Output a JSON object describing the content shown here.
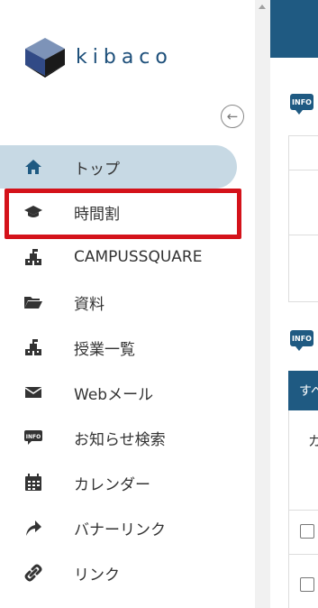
{
  "app": {
    "name": "kibaco"
  },
  "sidebar": {
    "collapse_icon": "arrow-left-circle-icon",
    "items": [
      {
        "label": "トップ",
        "icon": "home-icon",
        "active": true
      },
      {
        "label": "時間割",
        "icon": "graduation-cap-icon",
        "active": false
      },
      {
        "label": "CAMPUSSQUARE",
        "icon": "school-building-icon",
        "active": false
      },
      {
        "label": "資料",
        "icon": "folder-open-icon",
        "active": false
      },
      {
        "label": "授業一覧",
        "icon": "school-building-icon",
        "active": false
      },
      {
        "label": "Webメール",
        "icon": "envelope-icon",
        "active": false
      },
      {
        "label": "お知らせ検索",
        "icon": "info-chat-icon",
        "active": false
      },
      {
        "label": "カレンダー",
        "icon": "calendar-icon",
        "active": false
      },
      {
        "label": "バナーリンク",
        "icon": "share-arrow-icon",
        "active": false
      },
      {
        "label": "リンク",
        "icon": "link-icon",
        "active": false
      }
    ]
  },
  "main": {
    "info_badge": "INFO",
    "tab_partial": "すべ",
    "cell_partial": "カ"
  },
  "colors": {
    "brand": "#1f5a82",
    "active_bg": "#c7d9e4",
    "highlight": "#d4121a"
  }
}
